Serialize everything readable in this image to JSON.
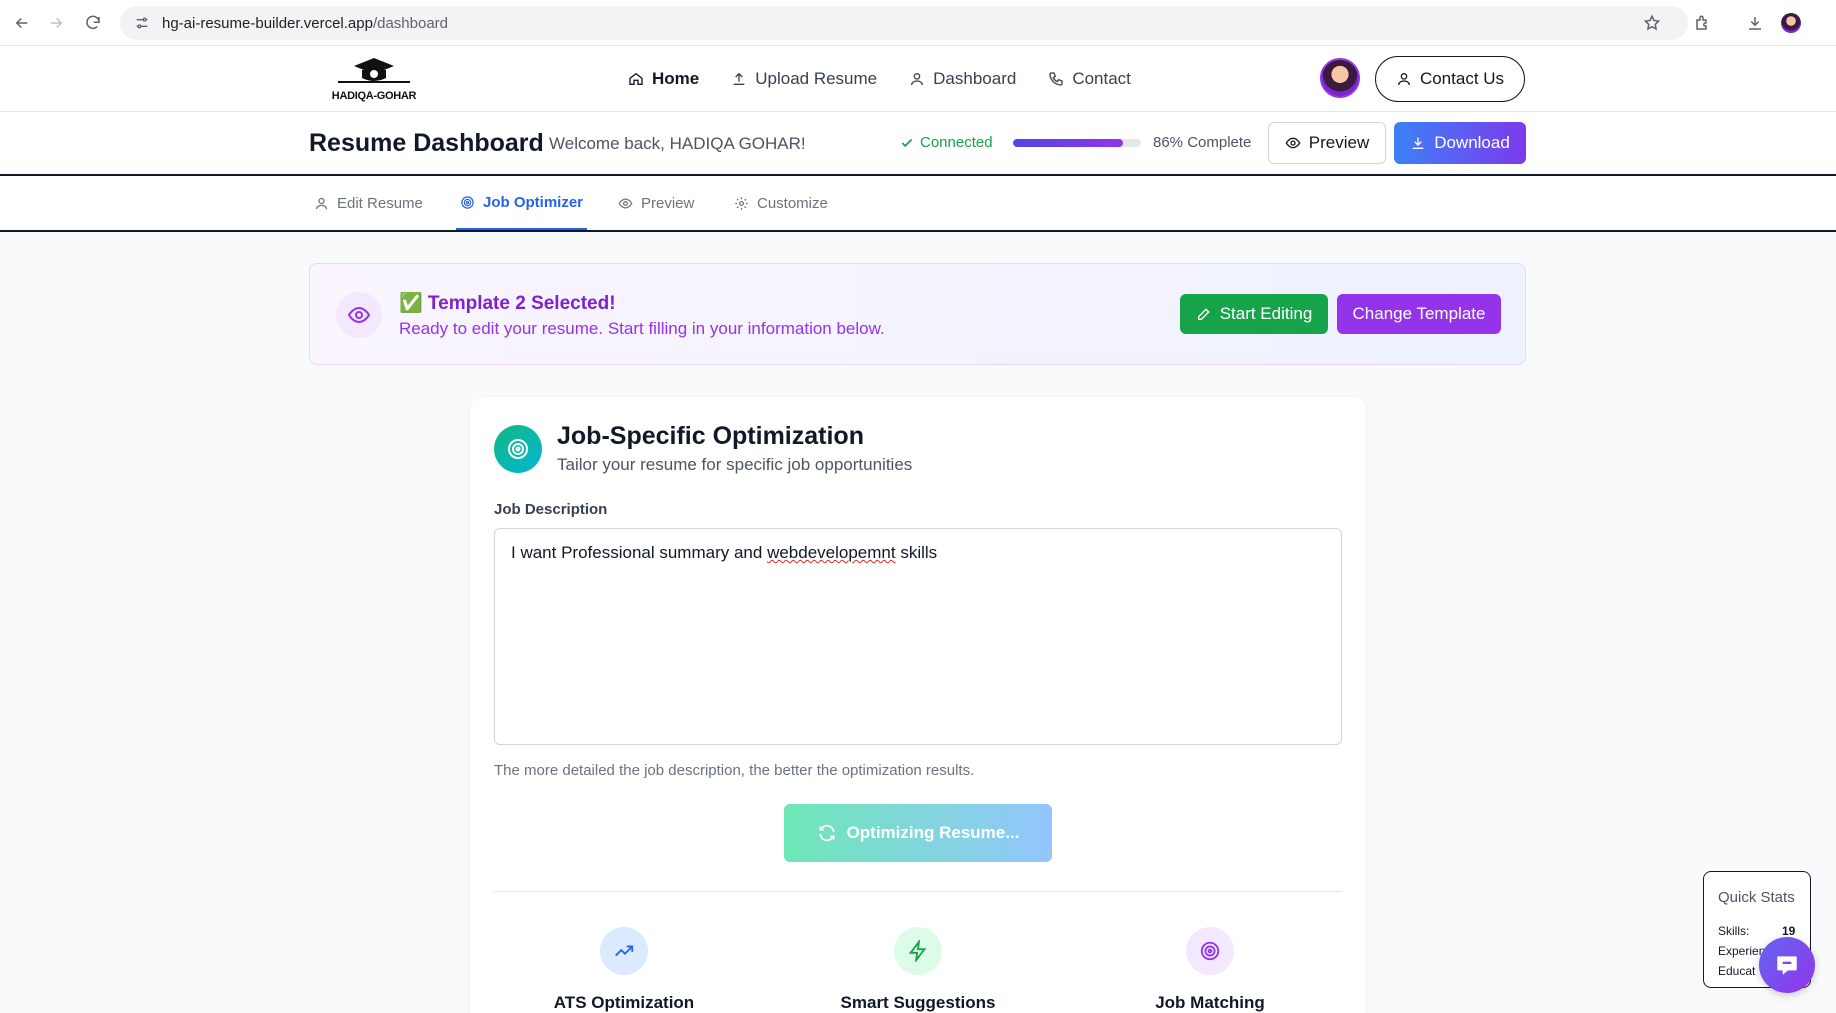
{
  "browser": {
    "url_host": "hg-ai-resume-builder.vercel.app",
    "url_path": "/dashboard"
  },
  "header": {
    "logo_text": "HADIQA-GOHAR",
    "nav": [
      {
        "label": "Home",
        "icon": "home-icon"
      },
      {
        "label": "Upload Resume",
        "icon": "upload-icon"
      },
      {
        "label": "Dashboard",
        "icon": "user-icon"
      },
      {
        "label": "Contact",
        "icon": "phone-icon"
      }
    ],
    "contact_button": "Contact Us"
  },
  "dashboard": {
    "title": "Resume Dashboard",
    "welcome": "Welcome back, HADIQA GOHAR!",
    "status": "Connected",
    "progress_fraction": 0.86,
    "progress_label": "86% Complete",
    "preview_button": "Preview",
    "download_button": "Download",
    "colors": {
      "accent": "#2563eb",
      "success": "#16a34a",
      "purple": "#9333ea"
    }
  },
  "tabs": [
    {
      "label": "Edit Resume",
      "icon": "user-icon",
      "active": false
    },
    {
      "label": "Job Optimizer",
      "icon": "target-icon",
      "active": true
    },
    {
      "label": "Preview",
      "icon": "eye-icon",
      "active": false
    },
    {
      "label": "Customize",
      "icon": "gear-icon",
      "active": false
    }
  ],
  "banner": {
    "title": "✅ Template 2 Selected!",
    "subtitle": "Ready to edit your resume. Start filling in your information below.",
    "start_editing": "Start Editing",
    "change_template": "Change Template"
  },
  "optimizer": {
    "title": "Job-Specific Optimization",
    "subtitle": "Tailor your resume for specific job opportunities",
    "jd_label": "Job Description",
    "jd_value_before": "I want Professional summary and ",
    "jd_value_misspelled": "webdevelopemnt",
    "jd_value_after": " skills",
    "hint": "The more detailed the job description, the better the optimization results.",
    "button": "Optimizing Resume...",
    "features": [
      {
        "title": "ATS Optimization",
        "icon": "trending-up-icon"
      },
      {
        "title": "Smart Suggestions",
        "icon": "lightning-icon"
      },
      {
        "title": "Job Matching",
        "icon": "target-icon"
      }
    ]
  },
  "quick_stats": {
    "title": "Quick Stats",
    "skills_label": "Skills:",
    "skills_value": "19",
    "experience_label": "Experien",
    "education_label": "Educat"
  }
}
